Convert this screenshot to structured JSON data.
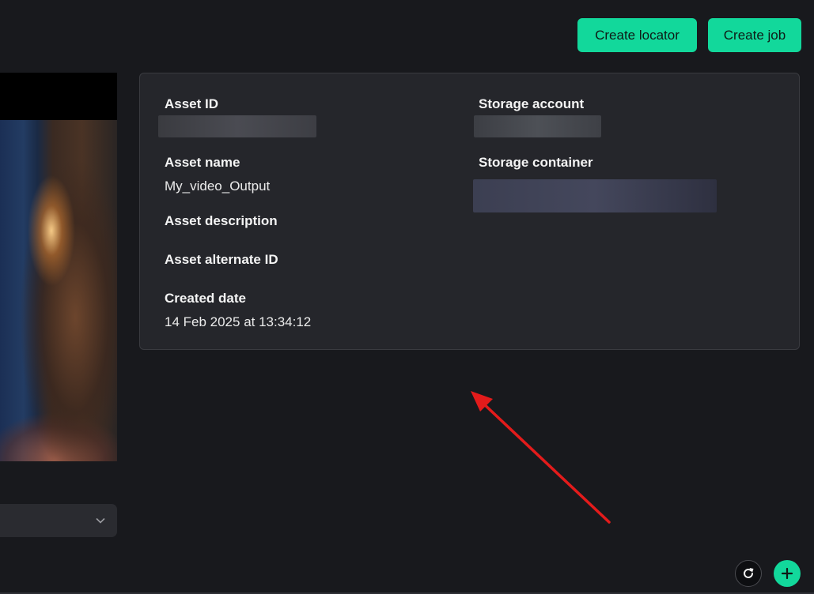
{
  "toolbar": {
    "create_locator_label": "Create locator",
    "create_job_label": "Create job"
  },
  "asset": {
    "asset_id_label": "Asset ID",
    "asset_name_label": "Asset name",
    "asset_name_value": "My_video_Output",
    "asset_description_label": "Asset description",
    "asset_alternate_id_label": "Asset alternate ID",
    "created_date_label": "Created date",
    "created_date_value": "14 Feb 2025 at 13:34:12",
    "storage_account_label": "Storage account",
    "storage_container_label": "Storage container"
  },
  "video_player": {
    "controls": [
      "cc-icon",
      "gear-icon",
      "fullscreen-icon"
    ]
  },
  "annotation": {
    "arrow_color": "#e31b1b"
  },
  "colors": {
    "accent": "#12d89b",
    "background": "#18191d",
    "card": "#25262b"
  }
}
